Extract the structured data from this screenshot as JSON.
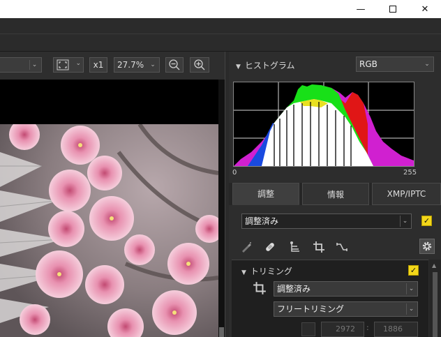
{
  "window": {
    "minimize": "—",
    "close": "✕"
  },
  "toolbar": {
    "zoom_1x_label": "x1",
    "zoom_level": "27.7%",
    "chevron": "⌄"
  },
  "histogram": {
    "title": "ヒストグラム",
    "channel": "RGB",
    "min_label": "0",
    "max_label": "255"
  },
  "tabs": [
    {
      "label": "調整"
    },
    {
      "label": "情報"
    },
    {
      "label": "XMP/IPTC"
    }
  ],
  "adjust": {
    "preset": "調整済み",
    "enabled_check": "✓"
  },
  "trimming": {
    "title": "トリミング",
    "enabled_check": "✓",
    "mode": "調整済み",
    "type": "フリートリミング",
    "width": "2972",
    "separator": ":",
    "height": "1886"
  },
  "icons": {
    "collapse": "▼",
    "scroll_up": "▲"
  }
}
